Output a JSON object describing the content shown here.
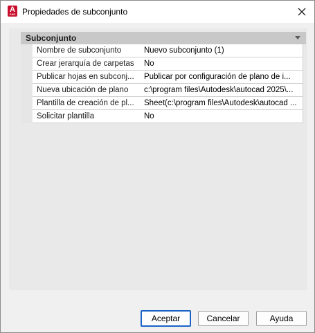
{
  "window": {
    "title": "Propiedades de subconjunto",
    "app_icon_letter": "A",
    "app_icon_small": "CAD",
    "accent": "#c8102e"
  },
  "category": {
    "label": "Subconjunto"
  },
  "properties": [
    {
      "name": "Nombre de subconjunto",
      "value": "Nuevo subconjunto (1)"
    },
    {
      "name": "Crear jerarquía de carpetas",
      "value": "No"
    },
    {
      "name": "Publicar hojas en subconj...",
      "value": "Publicar por configuración de plano de i..."
    },
    {
      "name": "Nueva ubicación de plano",
      "value": "c:\\program files\\Autodesk\\autocad 2025\\..."
    },
    {
      "name": "Plantilla de creación de pl...",
      "value": "Sheet(c:\\program files\\Autodesk\\autocad ..."
    },
    {
      "name": "Solicitar plantilla",
      "value": "No"
    }
  ],
  "buttons": {
    "ok": "Aceptar",
    "cancel": "Cancelar",
    "help": "Ayuda"
  }
}
